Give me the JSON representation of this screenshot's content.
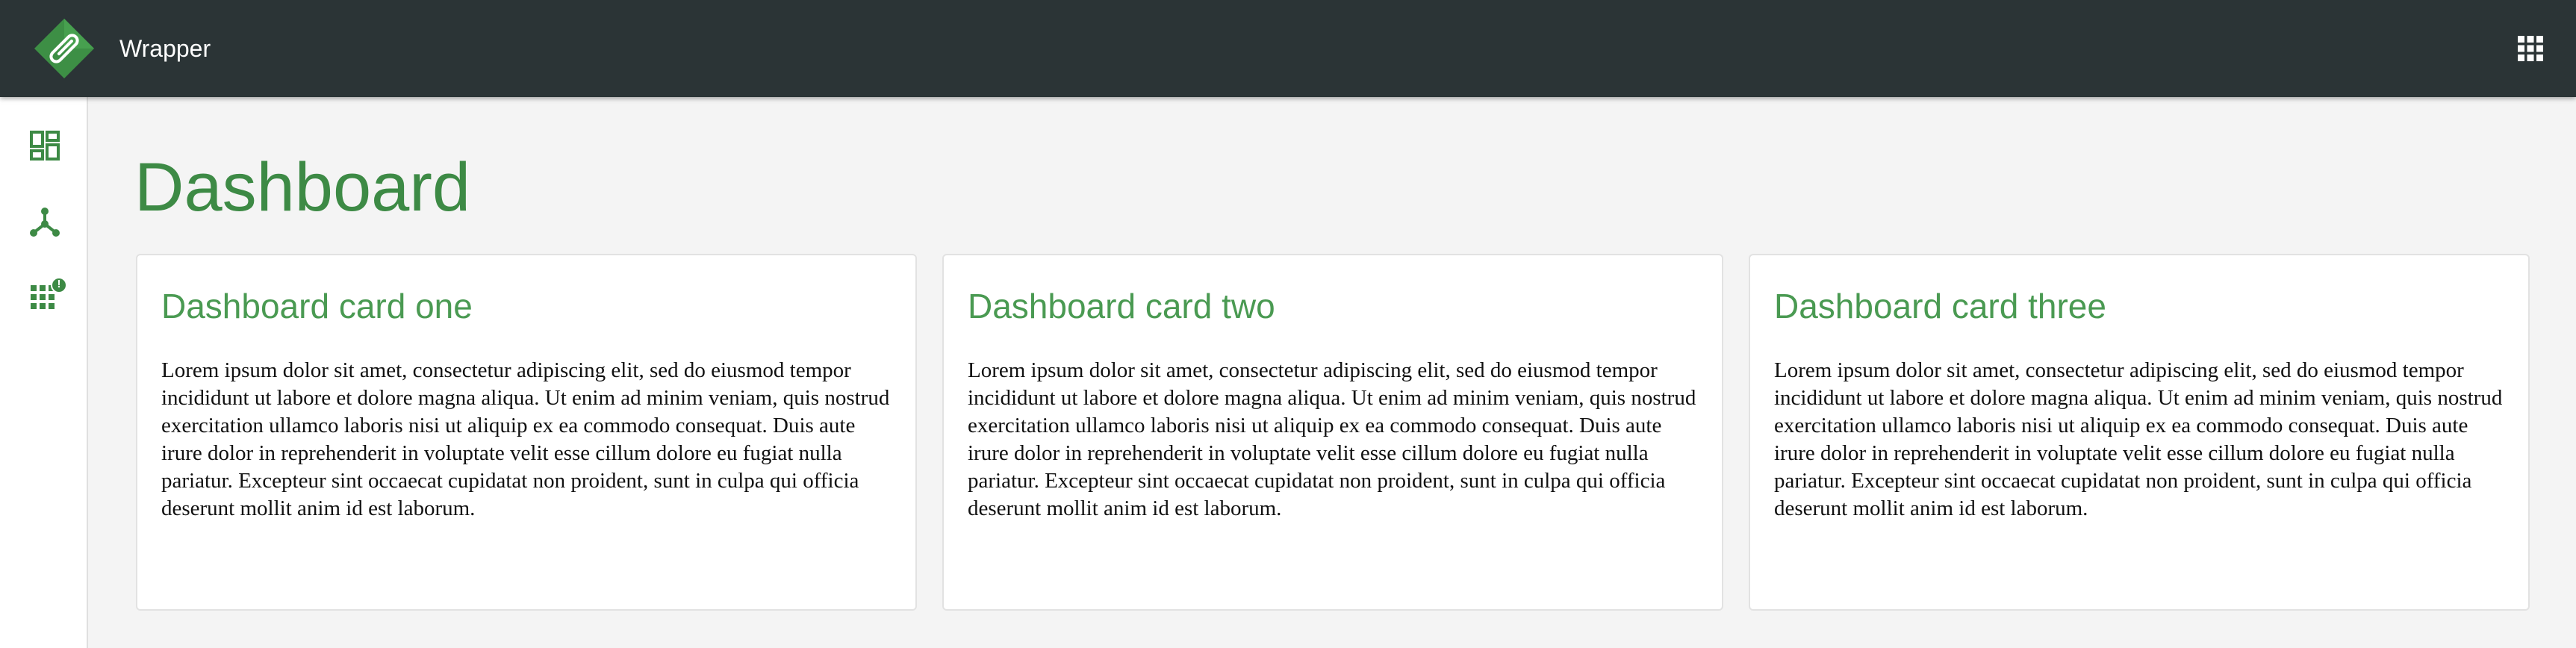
{
  "header": {
    "app_title": "Wrapper",
    "logo_icon": "paperclip-diamond-logo",
    "apps_icon": "grid-apps-icon"
  },
  "sidebar": {
    "items": [
      {
        "icon": "dashboard-icon"
      },
      {
        "icon": "hub-network-icon"
      },
      {
        "icon": "apps-grid-badge-icon",
        "badge": "!"
      }
    ]
  },
  "main": {
    "title": "Dashboard",
    "cards": [
      {
        "title": "Dashboard card one",
        "text": "Lorem ipsum dolor sit amet, consectetur adipiscing elit, sed do eiusmod tempor incididunt ut labore et dolore magna aliqua. Ut enim ad minim veniam, quis nostrud exercitation ullamco laboris nisi ut aliquip ex ea commodo consequat. Duis aute irure dolor in reprehenderit in voluptate velit esse cillum dolore eu fugiat nulla pariatur. Excepteur sint occaecat cupidatat non proident, sunt in culpa qui officia deserunt mollit anim id est laborum."
      },
      {
        "title": "Dashboard card two",
        "text": "Lorem ipsum dolor sit amet, consectetur adipiscing elit, sed do eiusmod tempor incididunt ut labore et dolore magna aliqua. Ut enim ad minim veniam, quis nostrud exercitation ullamco laboris nisi ut aliquip ex ea commodo consequat. Duis aute irure dolor in reprehenderit in voluptate velit esse cillum dolore eu fugiat nulla pariatur. Excepteur sint occaecat cupidatat non proident, sunt in culpa qui officia deserunt mollit anim id est laborum."
      },
      {
        "title": "Dashboard card three",
        "text": "Lorem ipsum dolor sit amet, consectetur adipiscing elit, sed do eiusmod tempor incididunt ut labore et dolore magna aliqua. Ut enim ad minim veniam, quis nostrud exercitation ullamco laboris nisi ut aliquip ex ea commodo consequat. Duis aute irure dolor in reprehenderit in voluptate velit esse cillum dolore eu fugiat nulla pariatur. Excepteur sint occaecat cupidatat non proident, sunt in culpa qui officia deserunt mollit anim id est laborum."
      }
    ]
  },
  "colors": {
    "topbar_bg": "#2b3436",
    "accent_green": "#3d8a45",
    "card_title_green": "#4a9a52",
    "page_bg": "#f4f4f4"
  }
}
